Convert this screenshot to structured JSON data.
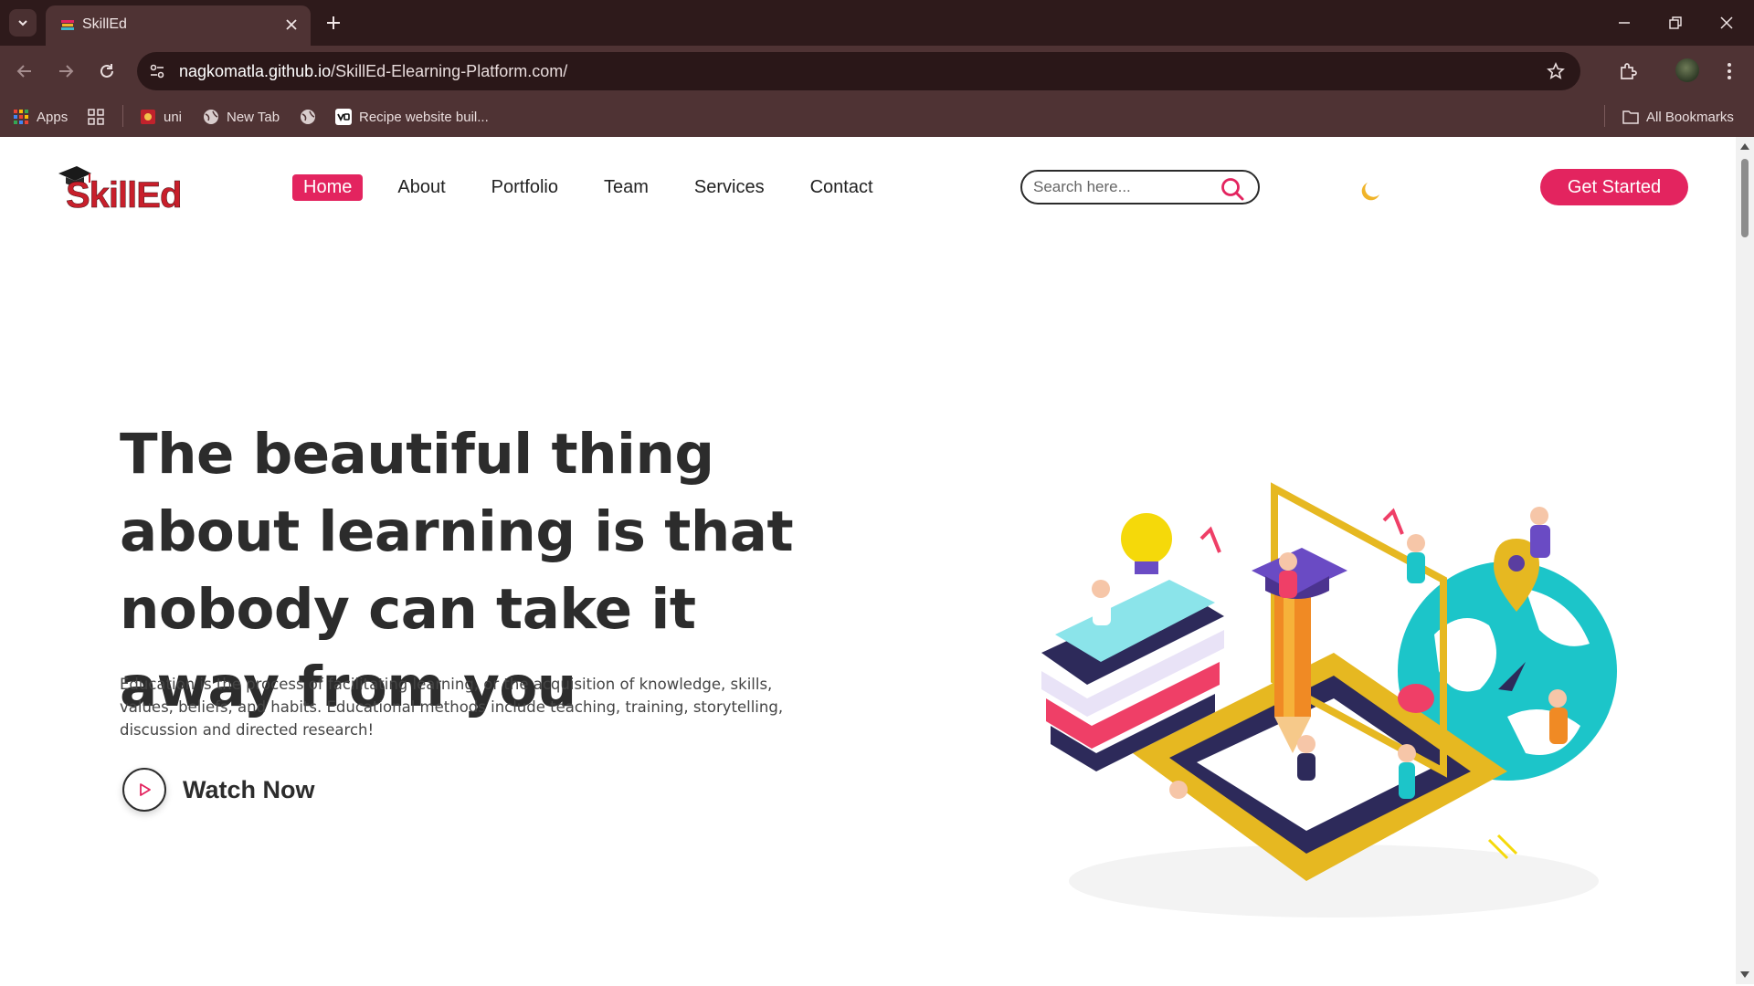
{
  "browser": {
    "tab_title": "SkillEd",
    "url_host": "nagkomatla.github.io",
    "url_path": "/SkillEd-Elearning-Platform.com/",
    "bookmarks": {
      "apps": "Apps",
      "uni": "uni",
      "new_tab": "New Tab",
      "recipe": "Recipe website buil...",
      "all_bookmarks": "All Bookmarks"
    }
  },
  "site": {
    "logo_text": "SkillEd",
    "nav": [
      "Home",
      "About",
      "Portfolio",
      "Team",
      "Services",
      "Contact"
    ],
    "search_placeholder": "Search here...",
    "cta_label": "Get Started"
  },
  "hero": {
    "title": "The beautiful thing about learning is that nobody can take it away from you",
    "description": "Education is the process of facilitating learning, or the acquisition of knowledge, skills, values, beliefs, and habits. Educational methods include teaching, training, storytelling, discussion and directed research!",
    "watch_label": "Watch Now"
  },
  "colors": {
    "accent": "#e3245f",
    "chrome_dark": "#2e1a1b",
    "chrome": "#4f3334"
  }
}
